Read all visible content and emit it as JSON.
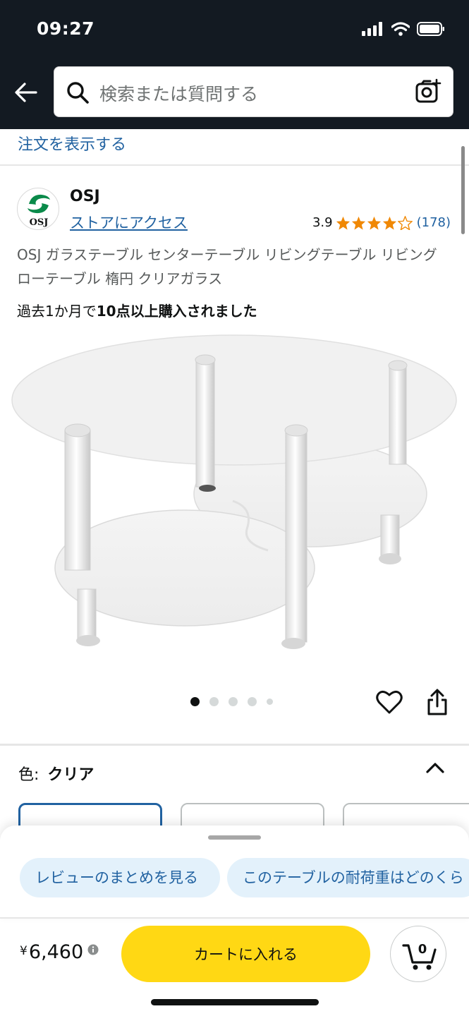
{
  "status_bar": {
    "time": "09:27"
  },
  "search": {
    "placeholder": "検索または質問する"
  },
  "order_link": "注文を表示する",
  "brand": {
    "name": "OSJ",
    "logo_text": "OSJ",
    "store_link": "ストアにアクセス"
  },
  "rating": {
    "value": "3.9",
    "stars": 3.9,
    "count": "(178)"
  },
  "product": {
    "title": "OSJ ガラステーブル センターテーブル リビングテーブル リビング ローテーブル 楕円 クリアガラス",
    "bought_prefix": "過去1か月で",
    "bought_bold": "10点以上購入されました"
  },
  "carousel": {
    "total": 5,
    "active": 1
  },
  "color": {
    "label": "色:",
    "value": "クリア"
  },
  "chips": [
    "レビューのまとめを見る",
    "このテーブルの耐荷重はどのくら"
  ],
  "price": {
    "symbol": "¥",
    "amount": "6,460"
  },
  "cart": {
    "button_label": "カートに入れる",
    "count": "0"
  },
  "colors": {
    "accent": "#2162a1",
    "header_bg": "#131a22",
    "cart_button": "#ffd814",
    "star": "#f08804",
    "chip_bg": "#e3f1fb"
  }
}
